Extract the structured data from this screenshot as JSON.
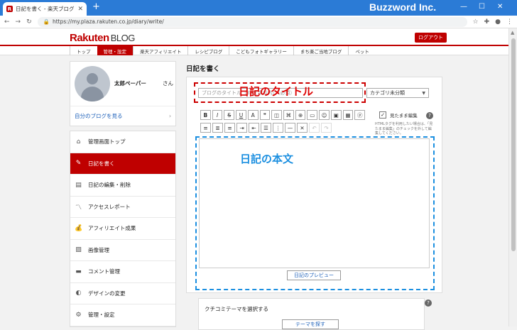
{
  "browser": {
    "tab_title": "日記を書く - 楽天ブログ",
    "tab_favicon": "R",
    "new_tab": "+",
    "url": "https://my.plaza.rakuten.co.jp/diary/write/",
    "brand_overlay": "Buzzword Inc.",
    "controls": {
      "minimize": "—",
      "maximize": "☐",
      "close": "✕"
    }
  },
  "header": {
    "logo_main": "Rakuten",
    "logo_sub": "BLOG",
    "logout": "ログアウト"
  },
  "nav": {
    "items": [
      {
        "label": "トップ"
      },
      {
        "label": "管理・設定"
      },
      {
        "label": "楽天アフィリエイト"
      },
      {
        "label": "レシピブログ"
      },
      {
        "label": "こどもフォトギャラリー"
      },
      {
        "label": "まち楽ご当地ブログ"
      },
      {
        "label": "ペット"
      }
    ]
  },
  "profile": {
    "name": "太郎ペーパー",
    "honorific": "さん",
    "my_blog_link": "自分のブログを見る"
  },
  "sidebar": {
    "items": [
      {
        "label": "管理画面トップ",
        "icon": "⌂"
      },
      {
        "label": "日記を書く",
        "icon": "✎"
      },
      {
        "label": "日記の編集・削除",
        "icon": "▤"
      },
      {
        "label": "アクセスレポート",
        "icon": "〽"
      },
      {
        "label": "アフィリエイト成果",
        "icon": "💰"
      },
      {
        "label": "画像管理",
        "icon": "▨"
      },
      {
        "label": "コメント管理",
        "icon": "▬"
      },
      {
        "label": "デザインの変更",
        "icon": "◐"
      },
      {
        "label": "管理・設定",
        "icon": "⚙"
      }
    ]
  },
  "main": {
    "heading": "日記を書く",
    "title_placeholder": "ブログのタイトル（30文字以内）（必須）",
    "category": "カテゴリ未分類",
    "annotation_title": "日記のタイトル",
    "annotation_body": "日記の本文",
    "toolbar_row1": [
      "B",
      "I",
      "S",
      "U",
      "A",
      "❞",
      "◫",
      "⌘",
      "⊕",
      "▭",
      "☺",
      "▣",
      "▦",
      "ⓟ"
    ],
    "toolbar_row2": [
      "≡",
      "≣",
      "≡",
      "⇥",
      "⇤",
      "☰",
      "⋮",
      "—",
      "✕",
      "↶",
      "↷"
    ],
    "raw_edit_checkbox": "✓",
    "raw_edit_label": "見たまま編集",
    "raw_edit_note": "HTMLタグを利用したい場合は、「見たまま編集」のチェックを外して編集してください。",
    "preview_button": "日記のプレビュー",
    "kuchikomi_label": "クチコミテーマを選択する",
    "theme_button": "テーマを探す",
    "help": "?"
  }
}
